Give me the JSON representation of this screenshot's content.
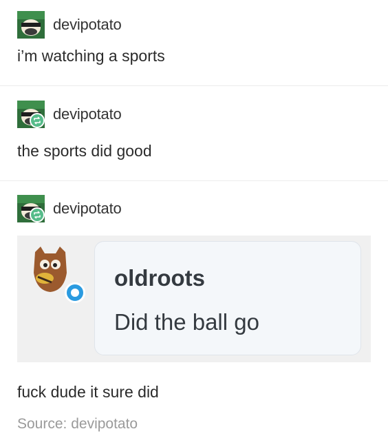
{
  "posts": [
    {
      "username": "devipotato",
      "text": "i’m watching a sports",
      "reblog": false
    },
    {
      "username": "devipotato",
      "text": "the sports did good",
      "reblog": true
    },
    {
      "username": "devipotato",
      "text": "fuck dude it sure did",
      "reblog": true
    }
  ],
  "chat": {
    "username": "oldroots",
    "message": "Did the ball go"
  },
  "source": "Source: devipotato",
  "colors": {
    "reblog_badge": "#56bc8a",
    "chat_badge": "#2b9be0",
    "chat_background": "#f0f0f0",
    "bubble_background": "#f4f7fa"
  },
  "icons": {
    "reblog": "reblog-icon",
    "user_avatar": "avatar-icon"
  }
}
